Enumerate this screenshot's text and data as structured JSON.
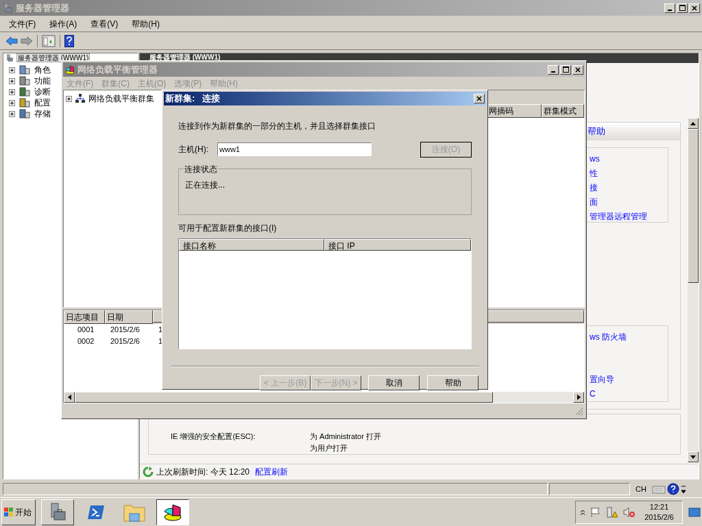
{
  "main_window": {
    "title": "服务器管理器",
    "menu": [
      "文件(F)",
      "操作(A)",
      "查看(V)",
      "帮助(H)"
    ],
    "tree": {
      "root": {
        "label": "服务器管理器 (WWW1)",
        "selected": true
      },
      "items": [
        {
          "label": "角色",
          "expanded": false
        },
        {
          "label": "功能",
          "expanded": false
        },
        {
          "label": "诊断",
          "expanded": false
        },
        {
          "label": "配置",
          "expanded": false
        },
        {
          "label": "存储",
          "expanded": false
        }
      ]
    },
    "pane_header": "服务器管理器 (WWW1)",
    "help_box": {
      "header": "帮助",
      "links": [
        "ws",
        "性",
        "接",
        "面",
        "管理器远程管理"
      ]
    },
    "security_box": {
      "links": [
        "ws 防火墙",
        "置向导",
        "C"
      ]
    },
    "esc": {
      "label": "IE 增强的安全配置(ESC):",
      "values": [
        "为 Administrator 打开",
        "为用户打开"
      ]
    },
    "refresh": {
      "text": "上次刷新时间: 今天 12:20",
      "link": "配置刷新"
    },
    "status_bar": {
      "language": "CH"
    }
  },
  "nlb_window": {
    "title": "网络负载平衡管理器",
    "menu": [
      {
        "label": "文件(F)",
        "disabled": true
      },
      {
        "label": "群集(C)",
        "disabled": true
      },
      {
        "label": "主机(O)",
        "disabled": true
      },
      {
        "label": "选项(P)",
        "disabled": true
      },
      {
        "label": "帮助(H)",
        "disabled": true
      }
    ],
    "tree": [
      {
        "label": "网络负载平衡群集",
        "expanded": false
      }
    ],
    "columns": [
      "网摘码",
      "群集模式"
    ],
    "log": {
      "columns": [
        "日志项目",
        "日期"
      ],
      "rows": [
        {
          "column_1": "0001",
          "column_2": "2015/2/6",
          "column_3": "1"
        },
        {
          "column_1": "0002",
          "column_2": "2015/2/6",
          "column_3": "1"
        }
      ]
    }
  },
  "dialog": {
    "title": "新群集:   连接",
    "instruction": "连接到作为新群集的一部分的主机，并且选择群集接口",
    "host_label": "主机(H):",
    "host_value": "www1",
    "connect_button": {
      "label": "连接(O)",
      "disabled": true
    },
    "status_group": {
      "title": "连接状态",
      "text": "正在连接..."
    },
    "interfaces_label": "可用于配置新群集的接口(I)",
    "interface_columns": [
      "接口名称",
      "接口 IP"
    ],
    "buttons": [
      {
        "label": "< 上一步(B)",
        "disabled": true
      },
      {
        "label": "下一步(N) >",
        "disabled": true
      },
      {
        "label": "取消",
        "disabled": false
      },
      {
        "label": "帮助",
        "disabled": false
      }
    ]
  },
  "taskbar": {
    "start": "开始",
    "apps": [
      {
        "kind": "server",
        "selected": false
      },
      {
        "kind": "shell",
        "selected": false
      },
      {
        "kind": "folder",
        "selected": false
      },
      {
        "kind": "chart",
        "selected": true
      }
    ],
    "time": "12:21",
    "date": "2015/2/6"
  }
}
